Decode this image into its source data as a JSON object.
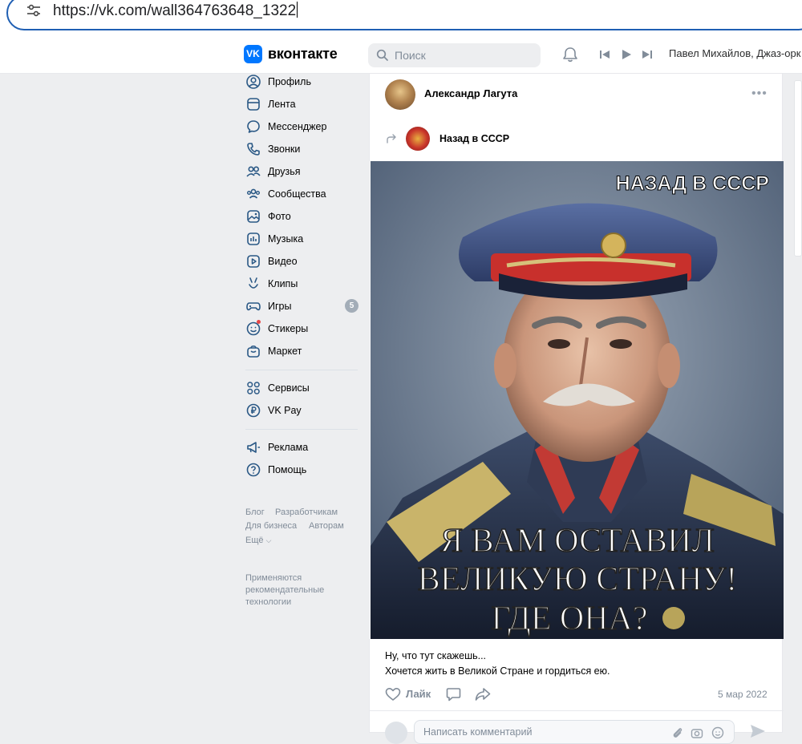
{
  "browser": {
    "url": "https://vk.com/wall364763648_1322"
  },
  "header": {
    "logo_glyph": "VK",
    "logo_text": "вконтакте",
    "search_placeholder": "Поиск",
    "now_playing": "Павел Михайлов, Джаз-орк"
  },
  "sidebar": {
    "items": [
      {
        "label": "Профиль",
        "icon": "profile-icon"
      },
      {
        "label": "Лента",
        "icon": "feed-icon"
      },
      {
        "label": "Мессенджер",
        "icon": "messenger-icon"
      },
      {
        "label": "Звонки",
        "icon": "phone-icon"
      },
      {
        "label": "Друзья",
        "icon": "friends-icon"
      },
      {
        "label": "Сообщества",
        "icon": "communities-icon"
      },
      {
        "label": "Фото",
        "icon": "photo-icon"
      },
      {
        "label": "Музыка",
        "icon": "music-icon"
      },
      {
        "label": "Видео",
        "icon": "video-icon"
      },
      {
        "label": "Клипы",
        "icon": "clips-icon"
      },
      {
        "label": "Игры",
        "icon": "games-icon",
        "badge": "5"
      },
      {
        "label": "Стикеры",
        "icon": "stickers-icon"
      },
      {
        "label": "Маркет",
        "icon": "market-icon"
      }
    ],
    "services": [
      {
        "label": "Сервисы",
        "icon": "services-icon"
      },
      {
        "label": "VK Pay",
        "icon": "vkpay-icon"
      }
    ],
    "extra": [
      {
        "label": "Реклама",
        "icon": "ads-icon"
      },
      {
        "label": "Помощь",
        "icon": "help-icon"
      }
    ],
    "footer_links": [
      "Блог",
      "Разработчикам",
      "Для бизнеса",
      "Авторам",
      "Ещё"
    ],
    "recommendation_note": "Применяются рекомендательные технологии"
  },
  "post": {
    "author": "Александр Лагута",
    "more": "•••",
    "repost_source": "Назад в СССР",
    "image": {
      "corner_caption": "НАЗАД В СССР",
      "caption_lines": [
        "Я ВАМ ОСТАВИЛ",
        "ВЕЛИКУЮ СТРАНУ!",
        "ГДЕ ОНА?"
      ]
    },
    "text_lines": [
      "Ну, что тут скажешь...",
      "Хочется жить в Великой Стране и гордиться ею."
    ],
    "like_label": "Лайк",
    "date": "5 мар 2022",
    "comment_placeholder": "Написать комментарий"
  },
  "colors": {
    "accent": "#0077ff",
    "icon_blue": "#2a5885",
    "muted": "#818c99",
    "page_bg": "#edeef0"
  }
}
